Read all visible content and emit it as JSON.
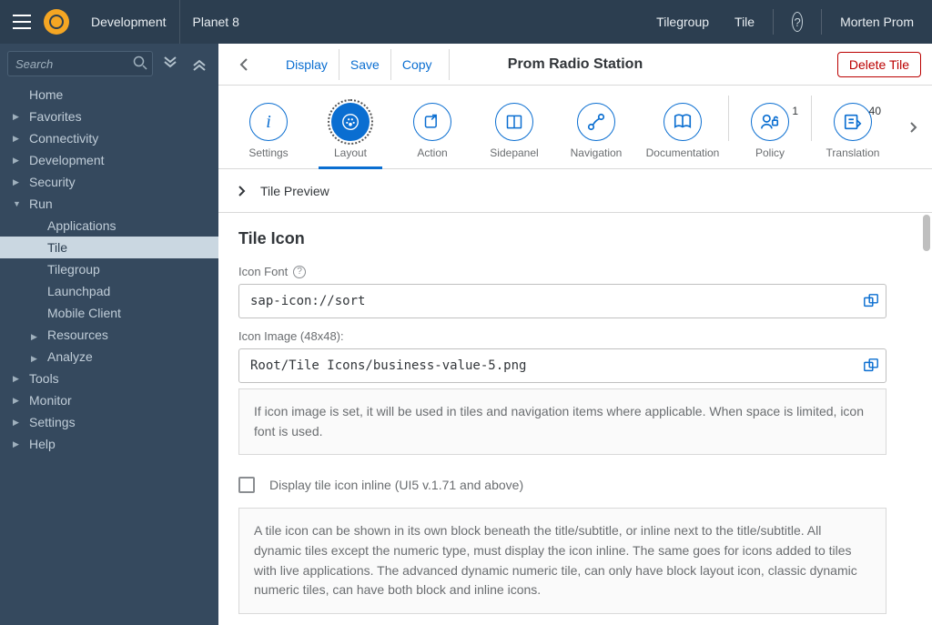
{
  "shell": {
    "env": "Development",
    "product": "Planet 8",
    "tilegroup": "Tilegroup",
    "tile": "Tile",
    "user": "Morten Prom"
  },
  "sidebar": {
    "search_placeholder": "Search",
    "items": [
      {
        "label": "Home"
      },
      {
        "label": "Favorites"
      },
      {
        "label": "Connectivity"
      },
      {
        "label": "Development"
      },
      {
        "label": "Security"
      },
      {
        "label": "Run"
      },
      {
        "label": "Tools"
      },
      {
        "label": "Monitor"
      },
      {
        "label": "Settings"
      },
      {
        "label": "Help"
      }
    ],
    "run_children": [
      {
        "label": "Applications"
      },
      {
        "label": "Tile"
      },
      {
        "label": "Tilegroup"
      },
      {
        "label": "Launchpad"
      },
      {
        "label": "Mobile Client"
      },
      {
        "label": "Resources"
      },
      {
        "label": "Analyze"
      }
    ]
  },
  "toolbar": {
    "display": "Display",
    "save": "Save",
    "copy": "Copy",
    "title": "Prom Radio Station",
    "delete": "Delete Tile"
  },
  "tabs": [
    {
      "label": "Settings"
    },
    {
      "label": "Layout"
    },
    {
      "label": "Action"
    },
    {
      "label": "Sidepanel"
    },
    {
      "label": "Navigation"
    },
    {
      "label": "Documentation"
    },
    {
      "label": "Policy",
      "badge": "1"
    },
    {
      "label": "Translation",
      "badge": "40"
    }
  ],
  "preview": {
    "label": "Tile Preview"
  },
  "form": {
    "section_title": "Tile Icon",
    "icon_font_label": "Icon Font",
    "icon_font_value": "sap-icon://sort",
    "icon_image_label": "Icon Image (48x48):",
    "icon_image_value": "Root/Tile Icons/business-value-5.png",
    "info1": "If icon image is set, it will be used in tiles and navigation items where applicable. When space is limited, icon font is used.",
    "inline_label": "Display tile icon inline (UI5 v.1.71 and above)",
    "info2": "A tile icon can be shown in its own block beneath the title/subtitle, or inline next to the title/subtitle. All dynamic tiles except the numeric type, must display the icon inline. The same goes for icons added to tiles with live applications. The advanced dynamic numeric tile, can only have block layout icon, classic dynamic numeric tiles, can have both block and inline icons."
  }
}
